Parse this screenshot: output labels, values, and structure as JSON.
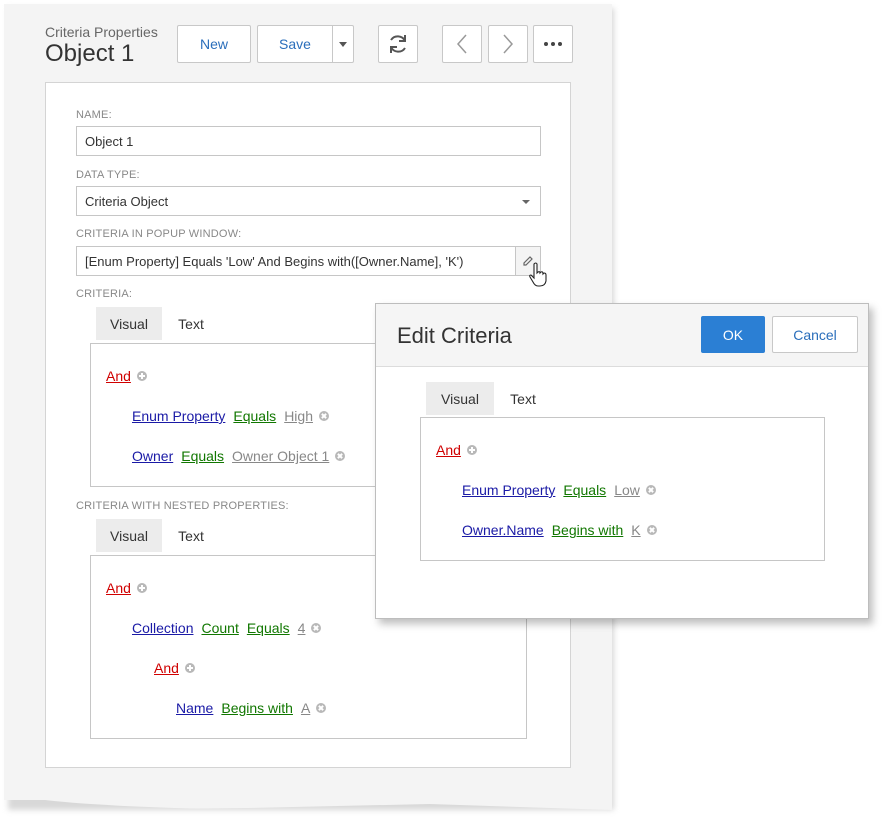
{
  "header": {
    "subtitle": "Criteria Properties",
    "title": "Object 1",
    "new_label": "New",
    "save_label": "Save"
  },
  "form": {
    "name_label": "NAME:",
    "name_value": "Object 1",
    "datatype_label": "DATA TYPE:",
    "datatype_value": "Criteria Object",
    "popup_criteria_label": "CRITERIA IN POPUP WINDOW:",
    "popup_criteria_value": "[Enum Property] Equals 'Low' And Begins with([Owner.Name], 'K')",
    "criteria_label": "CRITERIA:",
    "nested_label": "CRITERIA WITH NESTED PROPERTIES:"
  },
  "tabs": {
    "visual": "Visual",
    "text": "Text"
  },
  "criteria": {
    "group": "And",
    "rows": [
      {
        "field": "Enum Property",
        "op": "Equals",
        "value": "High"
      },
      {
        "field": "Owner",
        "op": "Equals",
        "value": "Owner Object 1"
      }
    ]
  },
  "nested": {
    "group": "And",
    "row1": {
      "field": "Collection",
      "agg": "Count",
      "op": "Equals",
      "value": "4"
    },
    "subgroup": "And",
    "row2": {
      "field": "Name",
      "op": "Begins with",
      "value": "A"
    }
  },
  "popup": {
    "title": "Edit Criteria",
    "ok_label": "OK",
    "cancel_label": "Cancel",
    "group": "And",
    "rows": [
      {
        "field": "Enum Property",
        "op": "Equals",
        "value": "Low"
      },
      {
        "field": "Owner.Name",
        "op": "Begins with",
        "value": "K"
      }
    ]
  },
  "colors": {
    "accent": "#2b7fd4",
    "group": "#d00000",
    "field": "#1a1aa6",
    "operator": "#117700",
    "value": "#888888"
  },
  "icons": [
    "refresh-icon",
    "chevron-left-icon",
    "chevron-right-icon",
    "more-icon",
    "caret-down-icon",
    "pencil-icon",
    "hand-cursor-icon",
    "add-condition-icon",
    "remove-condition-icon"
  ]
}
